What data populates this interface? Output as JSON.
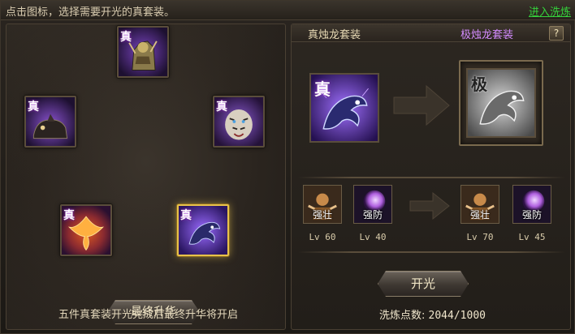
{
  "top": {
    "hint": "点击图标，选择需要开光的真套装。",
    "link": "进入洗炼"
  },
  "left": {
    "slots": [
      {
        "name": "mechanical-guardian",
        "tag": "真"
      },
      {
        "name": "shadow-beast",
        "tag": "真"
      },
      {
        "name": "white-tiger",
        "tag": "真"
      },
      {
        "name": "fire-phoenix",
        "tag": "真"
      },
      {
        "name": "azure-dragon",
        "tag": "真",
        "selected": true
      }
    ],
    "final_button": "最终升华",
    "note": "五件真套装开光完成后最终升华将开启"
  },
  "right": {
    "title_current": "真烛龙套装",
    "title_next": "极烛龙套装",
    "help": "?",
    "current_icon": {
      "tag": "真"
    },
    "next_icon": {
      "tag": "极"
    },
    "current_attrs": [
      {
        "label": "强壮",
        "level": "Lv 60"
      },
      {
        "label": "强防",
        "level": "Lv 40"
      }
    ],
    "next_attrs": [
      {
        "label": "强壮",
        "level": "Lv 70"
      },
      {
        "label": "强防",
        "level": "Lv 45"
      }
    ],
    "open_button": "开光",
    "points_label": "洗炼点数:",
    "points_value": "2044/1000"
  },
  "colors": {
    "accent_gold": "#e8c24a",
    "link_green": "#35d13b",
    "ultimate_purple": "#d48cff"
  }
}
